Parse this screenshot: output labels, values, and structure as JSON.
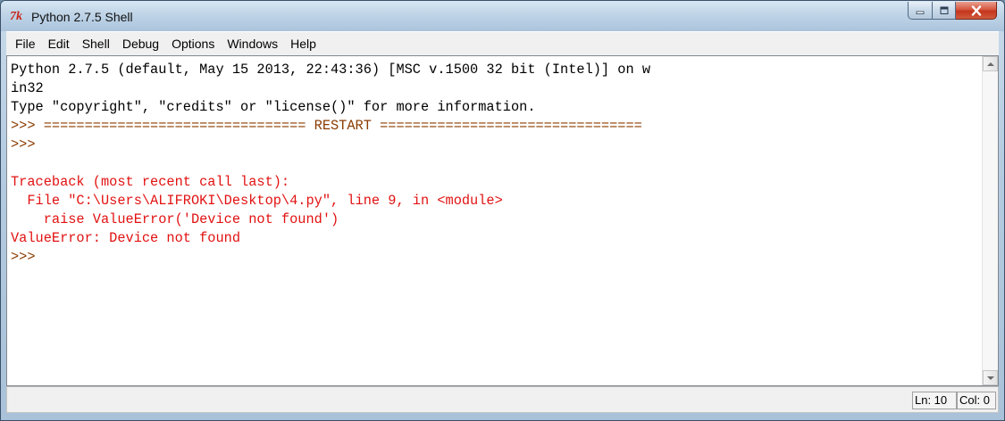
{
  "window": {
    "title": "Python 2.7.5 Shell",
    "icon": "tk-feather-icon",
    "caption_buttons": [
      "minimize-icon",
      "maximize-icon",
      "close-icon"
    ]
  },
  "menu": {
    "items": [
      "File",
      "Edit",
      "Shell",
      "Debug",
      "Options",
      "Windows",
      "Help"
    ]
  },
  "shell": {
    "lines": [
      {
        "text": "Python 2.7.5 (default, May 15 2013, 22:43:36) [MSC v.1500 32 bit (Intel)] on w",
        "kind": "out"
      },
      {
        "text": "in32",
        "kind": "out"
      },
      {
        "text": "Type \"copyright\", \"credits\" or \"license()\" for more information.",
        "kind": "out"
      },
      {
        "text": ">>> ================================ RESTART ================================",
        "kind": "prompt"
      },
      {
        "text": ">>> ",
        "kind": "prompt"
      },
      {
        "text": "",
        "kind": "out"
      },
      {
        "text": "Traceback (most recent call last):",
        "kind": "err"
      },
      {
        "text": "  File \"C:\\Users\\ALIFROKI\\Desktop\\4.py\", line 9, in <module>",
        "kind": "err"
      },
      {
        "text": "    raise ValueError('Device not found')",
        "kind": "err"
      },
      {
        "text": "ValueError: Device not found",
        "kind": "err"
      },
      {
        "text": ">>> ",
        "kind": "prompt"
      }
    ]
  },
  "status": {
    "ln_label": "Ln: 10",
    "col_label": "Col: 0"
  },
  "colors": {
    "stdout": "#000000",
    "prompt": "#8a3b00",
    "stderr": "#e21212"
  }
}
